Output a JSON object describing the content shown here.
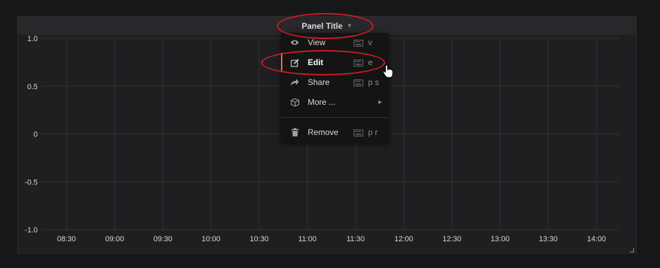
{
  "panel": {
    "title": "Panel Title",
    "caret_icon": "caret-down-icon"
  },
  "menu": {
    "items": [
      {
        "label": "View",
        "shortcut": "v",
        "icon": "eye-icon"
      },
      {
        "label": "Edit",
        "shortcut": "e",
        "icon": "edit-icon",
        "active": true
      },
      {
        "label": "Share",
        "shortcut": "p s",
        "icon": "share-icon"
      },
      {
        "label": "More ...",
        "shortcut": "",
        "icon": "cube-icon",
        "submenu": true
      },
      {
        "label": "Remove",
        "shortcut": "p r",
        "icon": "trash-icon"
      }
    ]
  },
  "colors": {
    "background": "#161719",
    "panel": "#1f1f22",
    "active_accent": "#eb7b18",
    "annotation": "#d01b26"
  },
  "chart_data": {
    "type": "line",
    "title": "",
    "xlabel": "",
    "ylabel": "",
    "x": [
      "08:30",
      "09:00",
      "09:30",
      "10:00",
      "10:30",
      "11:00",
      "11:30",
      "12:00",
      "12:30",
      "13:00",
      "13:30",
      "14:00"
    ],
    "y_ticks": [
      "1.0",
      "0.5",
      "0",
      "-0.5",
      "-1.0"
    ],
    "ylim": [
      -1.0,
      1.0
    ],
    "series": [],
    "grid": true
  }
}
